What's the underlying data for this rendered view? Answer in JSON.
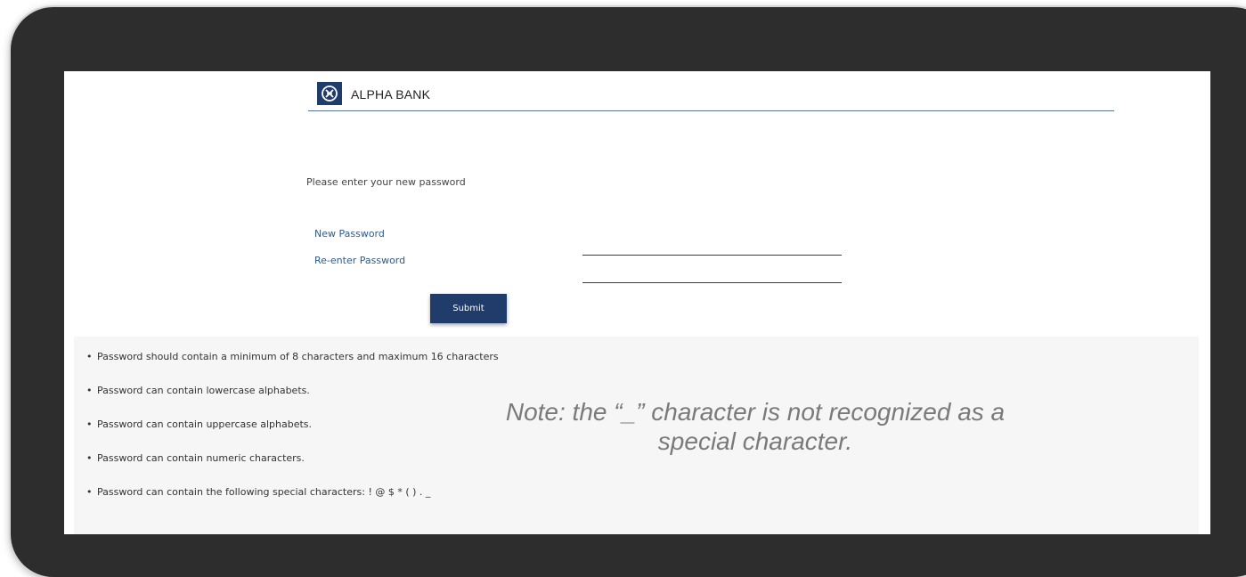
{
  "brand": {
    "name": "ALPHA BANK",
    "logo_icon": "alpha-bank-logo-icon",
    "accent_color": "#1f3c6b"
  },
  "form": {
    "instruction": "Please enter your new password",
    "new_password_label": "New Password",
    "reenter_password_label": "Re-enter Password",
    "new_password_value": "",
    "reenter_password_value": "",
    "submit_label": "Submit"
  },
  "rules": [
    "Password should contain a minimum of 8 characters and maximum 16 characters",
    "Password can contain lowercase alphabets.",
    "Password can contain uppercase alphabets.",
    "Password can contain numeric characters.",
    "Password can contain the following special characters: ! @ $ * ( ) . _"
  ],
  "note": "Note: the “_” character is not recognized as a special character."
}
